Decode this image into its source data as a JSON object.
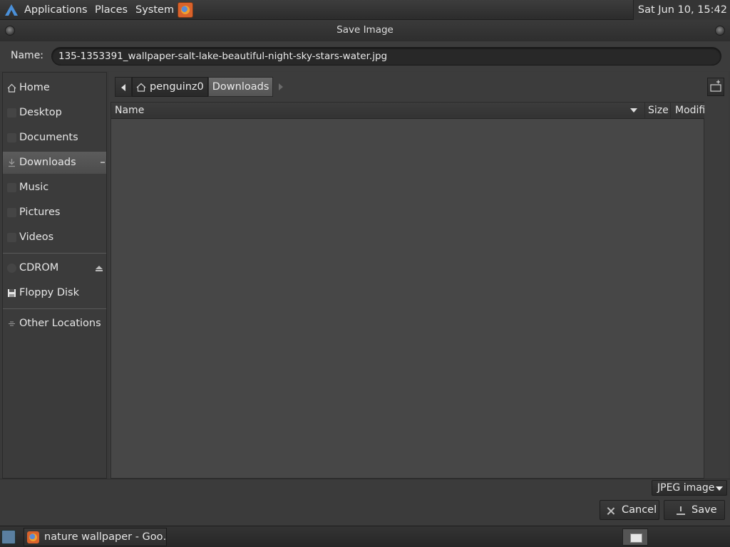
{
  "top_panel": {
    "menus": [
      "Applications",
      "Places",
      "System"
    ],
    "clock": "Sat Jun 10, 15:42"
  },
  "dialog": {
    "title": "Save Image",
    "name_label": "Name:",
    "file_name": "135-1353391_wallpaper-salt-lake-beautiful-night-sky-stars-water.jpg",
    "sidebar": {
      "items": [
        {
          "label": "Home",
          "icon": "home-icon"
        },
        {
          "label": "Desktop",
          "icon": "desktop-icon"
        },
        {
          "label": "Documents",
          "icon": "documents-icon"
        },
        {
          "label": "Downloads",
          "icon": "downloads-icon",
          "selected": true
        },
        {
          "label": "Music",
          "icon": "music-icon"
        },
        {
          "label": "Pictures",
          "icon": "pictures-icon"
        },
        {
          "label": "Videos",
          "icon": "videos-icon"
        },
        {
          "label": "CDROM",
          "icon": "cdrom-icon"
        },
        {
          "label": "Floppy Disk",
          "icon": "floppy-disk-icon"
        },
        {
          "label": "Other Locations",
          "icon": "network-icon"
        }
      ]
    },
    "path_bar": {
      "segments": [
        "penguinz0",
        "Downloads"
      ]
    },
    "columns": {
      "name": "Name",
      "size": "Size",
      "modified": "Modified"
    },
    "file_type": "JPEG image",
    "cancel_label": "Cancel",
    "save_label": "Save"
  },
  "taskbar": {
    "task_label": "nature wallpaper - Goo…"
  }
}
